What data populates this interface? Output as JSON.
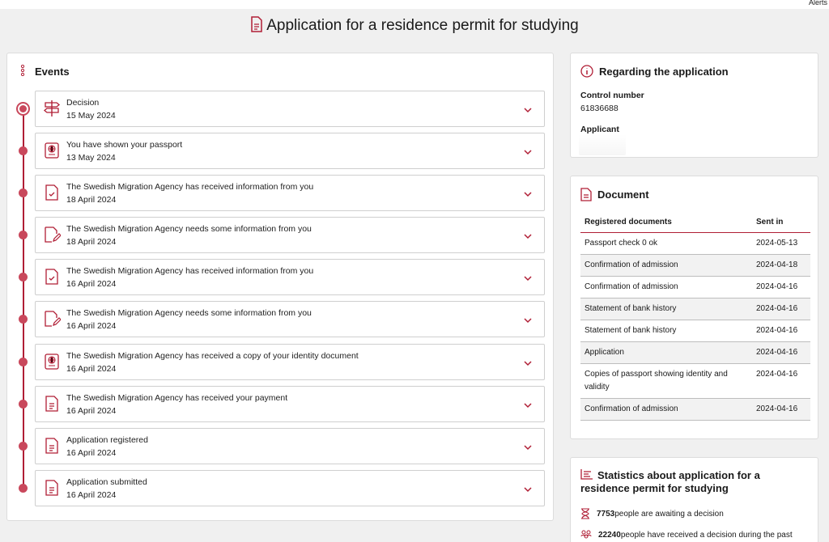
{
  "topbar": {
    "alerts": "Alerts"
  },
  "page_title": "Application for a residence permit for studying",
  "events": {
    "heading": "Events",
    "items": [
      {
        "title": "Decision",
        "date": "15 May 2024",
        "icon": "signpost-icon"
      },
      {
        "title": "You have shown your passport",
        "date": "13 May 2024",
        "icon": "passport-icon"
      },
      {
        "title": "The Swedish Migration Agency has received information from you",
        "date": "18 April 2024",
        "icon": "document-check-icon"
      },
      {
        "title": "The Swedish Migration Agency needs some information from you",
        "date": "18 April 2024",
        "icon": "document-edit-icon"
      },
      {
        "title": "The Swedish Migration Agency has received information from you",
        "date": "16 April 2024",
        "icon": "document-check-icon"
      },
      {
        "title": "The Swedish Migration Agency needs some information from you",
        "date": "16 April 2024",
        "icon": "document-edit-icon"
      },
      {
        "title": "The Swedish Migration Agency has received a copy of your identity document",
        "date": "16 April 2024",
        "icon": "passport-icon"
      },
      {
        "title": "The Swedish Migration Agency has received your payment",
        "date": "16 April 2024",
        "icon": "document-lines-icon"
      },
      {
        "title": "Application registered",
        "date": "16 April 2024",
        "icon": "document-lines-icon"
      },
      {
        "title": "Application submitted",
        "date": "16 April 2024",
        "icon": "document-lines-icon"
      }
    ]
  },
  "regarding": {
    "heading": "Regarding the application",
    "control_label": "Control number",
    "control_value": "61836688",
    "applicant_label": "Applicant"
  },
  "documents": {
    "heading": "Document",
    "col_doc": "Registered documents",
    "col_sent": "Sent in",
    "rows": [
      {
        "name": "Passport check 0 ok",
        "date": "2024-05-13"
      },
      {
        "name": "Confirmation of admission",
        "date": "2024-04-18"
      },
      {
        "name": "Confirmation of admission",
        "date": "2024-04-16"
      },
      {
        "name": "Statement of bank history",
        "date": "2024-04-16"
      },
      {
        "name": "Statement of bank history",
        "date": "2024-04-16"
      },
      {
        "name": "Application",
        "date": "2024-04-16"
      },
      {
        "name": "Copies of passport showing identity and validity",
        "date": "2024-04-16"
      },
      {
        "name": "Confirmation of admission",
        "date": "2024-04-16"
      }
    ]
  },
  "statistics": {
    "heading": "Statistics about application for a residence permit for studying",
    "awaiting_count": "7753",
    "awaiting_text": " people are awaiting a decision",
    "received_count": "22240",
    "received_text": " people have received a decision during the past"
  },
  "colors": {
    "accent": "#b01e35",
    "dot": "#c9485c"
  }
}
